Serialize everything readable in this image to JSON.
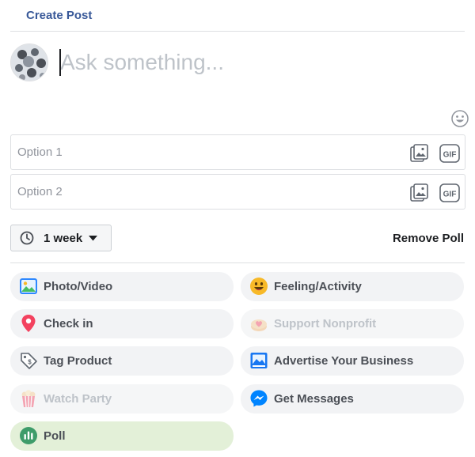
{
  "header": {
    "title": "Create Post"
  },
  "composer": {
    "placeholder": "Ask something..."
  },
  "poll": {
    "options": [
      {
        "placeholder": "Option 1",
        "value": ""
      },
      {
        "placeholder": "Option 2",
        "value": ""
      }
    ],
    "gif_label": "GIF",
    "duration": "1 week",
    "remove_label": "Remove Poll"
  },
  "actions": [
    {
      "label": "Photo/Video",
      "icon": "photo-video-icon"
    },
    {
      "label": "Feeling/Activity",
      "icon": "smiley-icon"
    },
    {
      "label": "Check in",
      "icon": "location-pin-icon"
    },
    {
      "label": "Support Nonprofit",
      "icon": "donation-icon",
      "disabled": true
    },
    {
      "label": "Tag Product",
      "icon": "price-tag-icon"
    },
    {
      "label": "Advertise Your Business",
      "icon": "advertise-icon"
    },
    {
      "label": "Watch Party",
      "icon": "popcorn-icon",
      "disabled": true
    },
    {
      "label": "Get Messages",
      "icon": "messenger-icon"
    },
    {
      "label": "Poll",
      "icon": "poll-icon",
      "selected": true
    }
  ],
  "colors": {
    "accent": "#385898",
    "photo_green": "#45bd62",
    "checkin_red": "#f3425f",
    "feeling_yellow": "#f7b928",
    "poll_green": "#3e9c6a",
    "messenger_blue": "#0084ff",
    "selected_bg": "#e3f0d8"
  }
}
